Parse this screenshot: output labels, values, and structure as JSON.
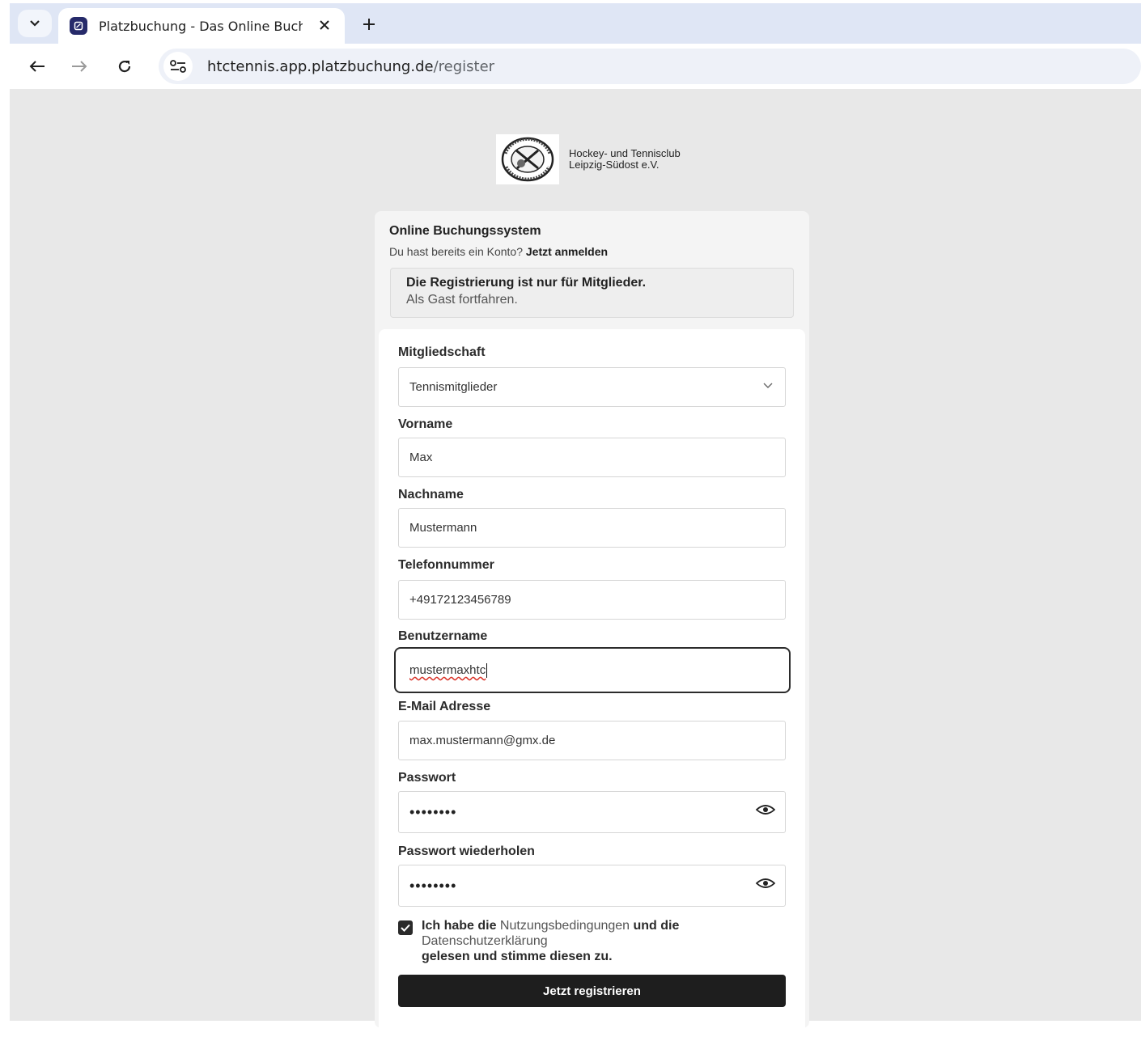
{
  "browser": {
    "tab_title": "Platzbuchung - Das Online Buchungssystem",
    "url_host": "htctennis.app.platzbuchung.de",
    "url_path": "/register"
  },
  "club": {
    "name": "Hockey- und Tennisclub Leipzig-Südost e.V.",
    "logo_text": "HOCKEY · TENNIS · CLUB · LEIPZIG · SÜDOST e.V."
  },
  "card": {
    "title": "Online Buchungssystem",
    "login_prompt": "Du hast bereits ein Konto?",
    "login_link": "Jetzt anmelden",
    "notice": "Die Registrierung ist nur für Mitglieder.",
    "guest_link": "Als Gast fortfahren."
  },
  "form": {
    "membership": {
      "label": "Mitgliedschaft",
      "value": "Tennismitglieder"
    },
    "firstname": {
      "label": "Vorname",
      "value": "Max"
    },
    "lastname": {
      "label": "Nachname",
      "value": "Mustermann"
    },
    "phone": {
      "label": "Telefonnummer",
      "value": "+49172123456789"
    },
    "username": {
      "label": "Benutzername",
      "value": "mustermaxhtc"
    },
    "email": {
      "label": "E-Mail Adresse",
      "value": "max.mustermann@gmx.de"
    },
    "password": {
      "label": "Passwort",
      "value": "••••••••"
    },
    "password_repeat": {
      "label": "Passwort wiederholen",
      "value": "••••••••"
    },
    "terms": {
      "checked": true,
      "part1": "Ich habe die ",
      "link1": "Nutzungsbedingungen",
      "part2": " und die ",
      "link2": "Datenschutzerklärung",
      "part3": "gelesen und stimme diesen zu."
    },
    "submit_label": "Jetzt registrieren"
  },
  "colors": {
    "tabbar_bg": "#dfe6f5",
    "page_bg": "#e8e8e8",
    "button_bg": "#1e1e1e"
  }
}
